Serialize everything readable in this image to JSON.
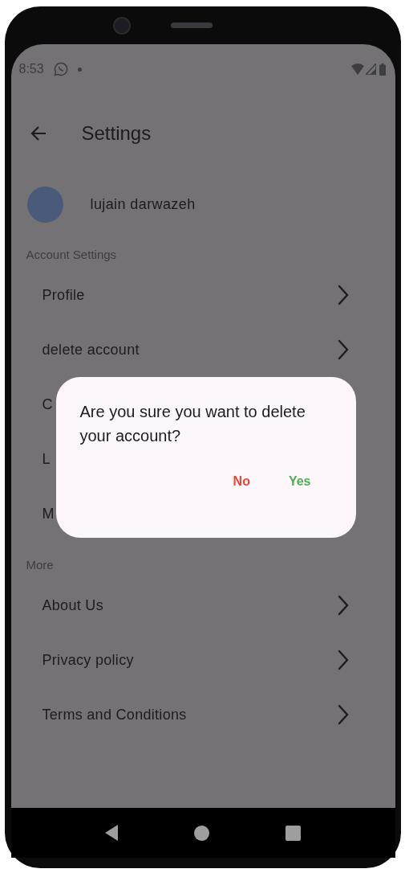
{
  "status_bar": {
    "time": "8:53"
  },
  "app_bar": {
    "title": "Settings"
  },
  "user": {
    "name": "lujain darwazeh"
  },
  "sections": [
    {
      "title": "Account Settings",
      "items": [
        {
          "label": "Profile",
          "kind": "full"
        },
        {
          "label": "delete account",
          "kind": "full"
        },
        {
          "label": "C",
          "kind": "covered"
        },
        {
          "label": "L",
          "kind": "covered"
        },
        {
          "label": "M",
          "kind": "covered"
        }
      ]
    },
    {
      "title": "More",
      "items": [
        {
          "label": "About Us",
          "kind": "full"
        },
        {
          "label": "Privacy policy",
          "kind": "full"
        },
        {
          "label": "Terms and Conditions",
          "kind": "full"
        }
      ]
    }
  ],
  "dialog": {
    "message": "Are you sure you want to delete your account?",
    "actions": [
      {
        "label": "No",
        "color": "#f44336"
      },
      {
        "label": "Yes",
        "color": "#4caf50"
      }
    ]
  }
}
